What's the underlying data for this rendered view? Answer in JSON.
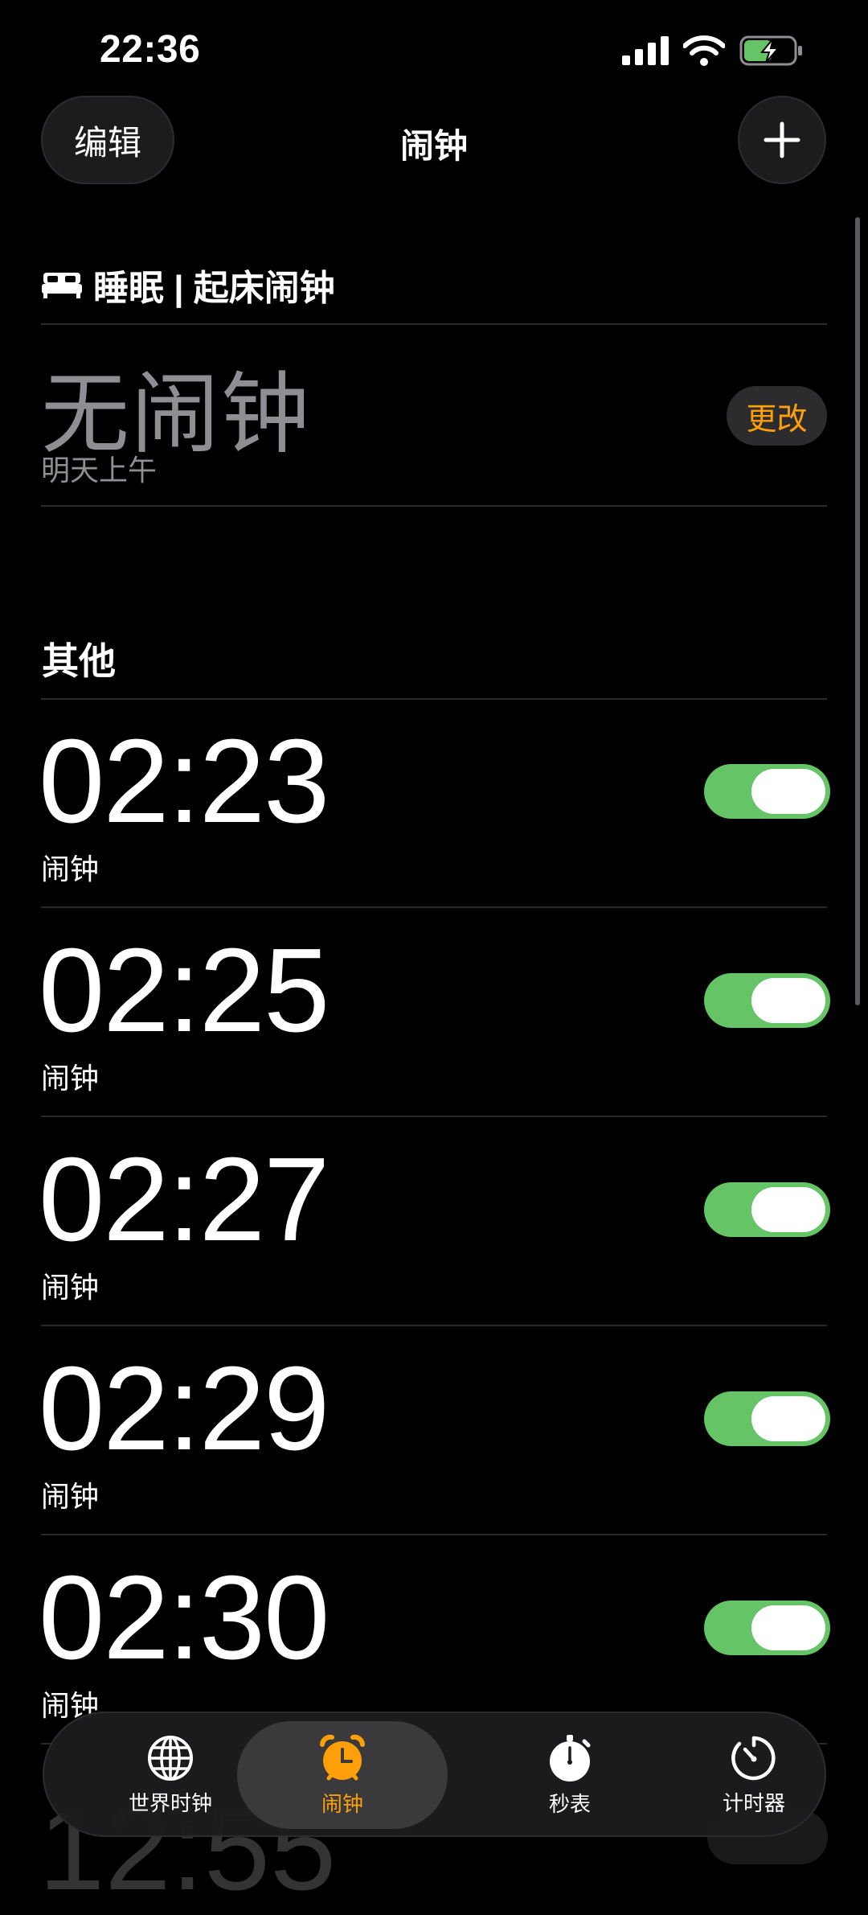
{
  "status": {
    "time": "22:36"
  },
  "nav": {
    "edit_label": "编辑",
    "title": "闹钟"
  },
  "sleep": {
    "section_title": "睡眠 | 起床闹钟",
    "status_text": "无闹钟",
    "subtitle": "明天上午",
    "change_label": "更改"
  },
  "other": {
    "section_title": "其他",
    "alarms": [
      {
        "time": "02:23",
        "label": "闹钟",
        "enabled": true
      },
      {
        "time": "02:25",
        "label": "闹钟",
        "enabled": true
      },
      {
        "time": "02:27",
        "label": "闹钟",
        "enabled": true
      },
      {
        "time": "02:29",
        "label": "闹钟",
        "enabled": true
      },
      {
        "time": "02:30",
        "label": "闹钟",
        "enabled": true
      }
    ],
    "partially_hidden_time": "12:55"
  },
  "tabs": [
    {
      "label": "世界时钟",
      "icon": "globe-icon",
      "active": false
    },
    {
      "label": "闹钟",
      "icon": "alarm-clock-icon",
      "active": true
    },
    {
      "label": "秒表",
      "icon": "stopwatch-icon",
      "active": false
    },
    {
      "label": "计时器",
      "icon": "timer-icon",
      "active": false
    }
  ],
  "colors": {
    "accent": "#ff9f0a",
    "toggle_on": "#65c466",
    "background": "#000000"
  }
}
